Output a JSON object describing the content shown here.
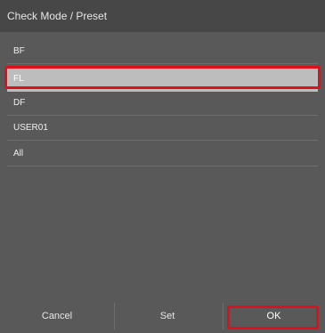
{
  "dialog": {
    "title": "Check Mode / Preset"
  },
  "presets": {
    "items": [
      {
        "label": "BF",
        "selected": false
      },
      {
        "label": "FL",
        "selected": true
      },
      {
        "label": "DF",
        "selected": false
      },
      {
        "label": "USER01",
        "selected": false
      },
      {
        "label": "All",
        "selected": false
      }
    ]
  },
  "footer": {
    "cancel_label": "Cancel",
    "set_label": "Set",
    "ok_label": "OK"
  },
  "colors": {
    "panel_bg": "#595959",
    "title_bg": "#474747",
    "selected_row_bg": "#bdbdbd",
    "annotation_red": "#e0101a"
  }
}
